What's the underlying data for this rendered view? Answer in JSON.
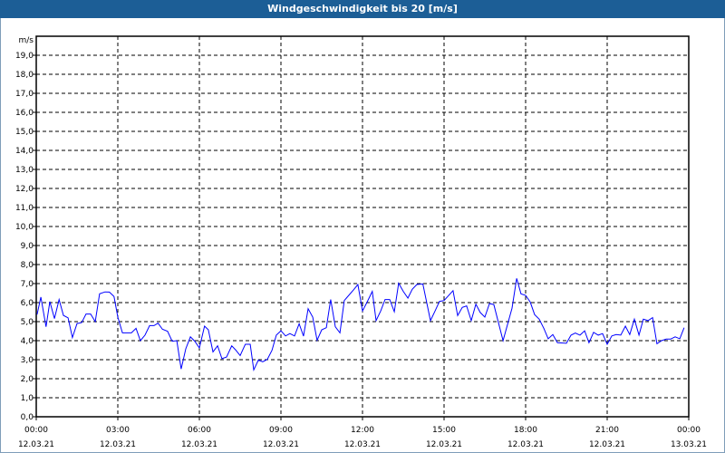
{
  "title": "Windgeschwindigkeit bis 20 [m/s]",
  "chart_data": {
    "type": "line",
    "title": "Windgeschwindigkeit bis 20 [m/s]",
    "ylabel": "m/s",
    "xlabel": "",
    "ylim": [
      0,
      20
    ],
    "xlim_hours": [
      0,
      24
    ],
    "grid": true,
    "y_ticks": [
      "0,0",
      "1,0",
      "2,0",
      "3,0",
      "4,0",
      "5,0",
      "6,0",
      "7,0",
      "8,0",
      "9,0",
      "10,0",
      "11,0",
      "12,0",
      "13,0",
      "14,0",
      "15,0",
      "16,0",
      "17,0",
      "18,0",
      "19,0"
    ],
    "x_ticks": [
      {
        "time": "00:00",
        "date": "12.03.21"
      },
      {
        "time": "03:00",
        "date": "12.03.21"
      },
      {
        "time": "06:00",
        "date": "12.03.21"
      },
      {
        "time": "09:00",
        "date": "12.03.21"
      },
      {
        "time": "12:00",
        "date": "12.03.21"
      },
      {
        "time": "15:00",
        "date": "12.03.21"
      },
      {
        "time": "18:00",
        "date": "12.03.21"
      },
      {
        "time": "21:00",
        "date": "12.03.21"
      },
      {
        "time": "00:00",
        "date": "13.03.21"
      }
    ],
    "series": [
      {
        "name": "Windgeschwindigkeit",
        "color": "#0000ff",
        "points": [
          [
            0.03,
            5.37
          ],
          [
            0.17,
            6.29
          ],
          [
            0.36,
            4.73
          ],
          [
            0.5,
            6.05
          ],
          [
            0.67,
            5.16
          ],
          [
            0.84,
            6.16
          ],
          [
            1.0,
            5.33
          ],
          [
            1.17,
            5.2
          ],
          [
            1.33,
            4.16
          ],
          [
            1.5,
            4.9
          ],
          [
            1.67,
            4.95
          ],
          [
            1.83,
            5.4
          ],
          [
            2.0,
            5.4
          ],
          [
            2.17,
            5.0
          ],
          [
            2.33,
            6.46
          ],
          [
            2.53,
            6.56
          ],
          [
            2.69,
            6.55
          ],
          [
            2.86,
            6.32
          ],
          [
            3.0,
            5.24
          ],
          [
            3.17,
            4.41
          ],
          [
            3.5,
            4.41
          ],
          [
            3.67,
            4.65
          ],
          [
            3.83,
            4.0
          ],
          [
            4.0,
            4.29
          ],
          [
            4.17,
            4.79
          ],
          [
            4.33,
            4.79
          ],
          [
            4.48,
            4.92
          ],
          [
            4.64,
            4.6
          ],
          [
            4.83,
            4.49
          ],
          [
            5.0,
            3.97
          ],
          [
            5.17,
            4.0
          ],
          [
            5.33,
            2.51
          ],
          [
            5.5,
            3.57
          ],
          [
            5.67,
            4.2
          ],
          [
            5.83,
            3.97
          ],
          [
            6.0,
            3.62
          ],
          [
            6.19,
            4.76
          ],
          [
            6.33,
            4.57
          ],
          [
            6.5,
            3.41
          ],
          [
            6.67,
            3.73
          ],
          [
            6.83,
            3.05
          ],
          [
            7.0,
            3.14
          ],
          [
            7.19,
            3.73
          ],
          [
            7.33,
            3.52
          ],
          [
            7.5,
            3.22
          ],
          [
            7.69,
            3.81
          ],
          [
            7.87,
            3.81
          ],
          [
            8.0,
            2.46
          ],
          [
            8.17,
            2.98
          ],
          [
            8.33,
            2.89
          ],
          [
            8.5,
            3.02
          ],
          [
            8.67,
            3.49
          ],
          [
            8.83,
            4.29
          ],
          [
            9.0,
            4.52
          ],
          [
            9.17,
            4.25
          ],
          [
            9.33,
            4.37
          ],
          [
            9.5,
            4.25
          ],
          [
            9.67,
            4.89
          ],
          [
            9.83,
            4.24
          ],
          [
            10.0,
            5.68
          ],
          [
            10.17,
            5.24
          ],
          [
            10.33,
            4.02
          ],
          [
            10.5,
            4.57
          ],
          [
            10.67,
            4.68
          ],
          [
            10.83,
            6.16
          ],
          [
            11.0,
            4.73
          ],
          [
            11.17,
            4.41
          ],
          [
            11.33,
            6.11
          ],
          [
            11.67,
            6.67
          ],
          [
            11.83,
            6.95
          ],
          [
            12.0,
            5.56
          ],
          [
            12.17,
            6.03
          ],
          [
            12.36,
            6.59
          ],
          [
            12.5,
            5.05
          ],
          [
            12.67,
            5.56
          ],
          [
            12.83,
            6.16
          ],
          [
            13.0,
            6.16
          ],
          [
            13.17,
            5.52
          ],
          [
            13.33,
            7.02
          ],
          [
            13.5,
            6.59
          ],
          [
            13.67,
            6.24
          ],
          [
            13.83,
            6.7
          ],
          [
            14.0,
            6.95
          ],
          [
            14.22,
            6.98
          ],
          [
            14.5,
            5.05
          ],
          [
            14.67,
            5.56
          ],
          [
            14.83,
            6.06
          ],
          [
            15.0,
            6.11
          ],
          [
            15.33,
            6.63
          ],
          [
            15.5,
            5.32
          ],
          [
            15.67,
            5.75
          ],
          [
            15.83,
            5.83
          ],
          [
            16.0,
            5.05
          ],
          [
            16.17,
            5.92
          ],
          [
            16.33,
            5.48
          ],
          [
            16.5,
            5.24
          ],
          [
            16.67,
            5.95
          ],
          [
            16.83,
            5.9
          ],
          [
            17.17,
            4.0
          ],
          [
            17.5,
            5.71
          ],
          [
            17.67,
            7.27
          ],
          [
            17.83,
            6.46
          ],
          [
            18.0,
            6.38
          ],
          [
            18.17,
            6.03
          ],
          [
            18.33,
            5.37
          ],
          [
            18.5,
            5.13
          ],
          [
            18.67,
            4.65
          ],
          [
            18.83,
            4.1
          ],
          [
            19.0,
            4.32
          ],
          [
            19.17,
            3.89
          ],
          [
            19.5,
            3.86
          ],
          [
            19.67,
            4.29
          ],
          [
            19.83,
            4.4
          ],
          [
            20.0,
            4.29
          ],
          [
            20.17,
            4.52
          ],
          [
            20.33,
            3.89
          ],
          [
            20.5,
            4.44
          ],
          [
            20.67,
            4.29
          ],
          [
            20.83,
            4.37
          ],
          [
            21.0,
            3.81
          ],
          [
            21.17,
            4.25
          ],
          [
            21.33,
            4.32
          ],
          [
            21.5,
            4.29
          ],
          [
            21.67,
            4.76
          ],
          [
            21.83,
            4.32
          ],
          [
            22.0,
            5.13
          ],
          [
            22.17,
            4.29
          ],
          [
            22.33,
            5.13
          ],
          [
            22.5,
            5.05
          ],
          [
            22.67,
            5.21
          ],
          [
            22.83,
            3.84
          ],
          [
            23.0,
            4.0
          ],
          [
            23.17,
            4.08
          ],
          [
            23.33,
            4.08
          ],
          [
            23.5,
            4.2
          ],
          [
            23.67,
            4.1
          ],
          [
            23.83,
            4.68
          ]
        ]
      }
    ]
  }
}
